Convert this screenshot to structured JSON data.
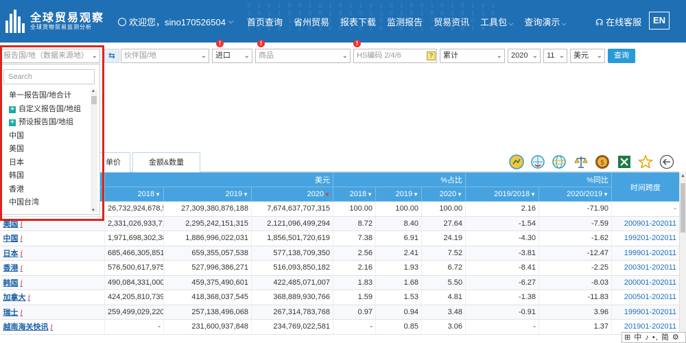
{
  "header": {
    "title": "全球贸易观察",
    "subtitle": "全球货物贸易监测分析",
    "user_text": "欢迎您，sino170526504",
    "nav": [
      {
        "label": "首页查询",
        "caret": false
      },
      {
        "label": "省州贸易",
        "caret": false
      },
      {
        "label": "报表下载",
        "caret": false
      },
      {
        "label": "监测报告",
        "caret": false
      },
      {
        "label": "贸易资讯",
        "caret": false
      },
      {
        "label": "工具包",
        "caret": true
      },
      {
        "label": "查询演示",
        "caret": true
      }
    ],
    "service": "在线客服",
    "lang": "EN"
  },
  "filters": {
    "reporter_placeholder": "报告国/地（数据来源地）",
    "partner_placeholder": "伙伴国/地",
    "flow": "进口",
    "commodity_placeholder": "商品",
    "hs_placeholder": "HS编码 2/4/6",
    "help": "?",
    "period_type": "累计",
    "year": "2020",
    "month": "11",
    "currency": "美元",
    "query_button": "查询",
    "warn": "!"
  },
  "dropdown": {
    "search_placeholder": "Search",
    "options": [
      {
        "label": "单一报告国/地合计",
        "plus": false
      },
      {
        "label": "自定义报告国/地组",
        "plus": true
      },
      {
        "label": "预设报告国/地组",
        "plus": true
      },
      {
        "label": "中国",
        "plus": false
      },
      {
        "label": "美国",
        "plus": false
      },
      {
        "label": "日本",
        "plus": false
      },
      {
        "label": "韩国",
        "plus": false
      },
      {
        "label": "香港",
        "plus": false
      },
      {
        "label": "中国台湾",
        "plus": false
      }
    ]
  },
  "tabs": [
    {
      "label": "单价"
    },
    {
      "label": "金额&数量"
    }
  ],
  "toolbar_icons": [
    "globe-chart-icon",
    "globe-refresh-icon",
    "globe-network-icon",
    "scale-icon",
    "coin-icon",
    "excel-icon",
    "star-icon",
    "back-arrow-icon"
  ],
  "table": {
    "group_headers": {
      "usd": "美元",
      "share": "%占比",
      "yoy": "%同比",
      "period": "时间跨度"
    },
    "columns": [
      "2018",
      "2019",
      "2020",
      "2018",
      "2019",
      "2020",
      "2019/2018",
      "2020/2019"
    ],
    "rows": [
      {
        "name": "",
        "marker": "",
        "v2018": "26,732,924,678,573",
        "v2019": "27,309,380,876,188",
        "v2020": "7,674,637,707,315",
        "s2018": "100.00",
        "s2019": "100.00",
        "s2020": "100.00",
        "y1": "2.16",
        "y2": "-71.90",
        "period": "-"
      },
      {
        "name": "美国",
        "marker": "i",
        "v2018": "2,331,026,933,719",
        "v2019": "2,295,242,151,315",
        "v2020": "2,121,096,499,294",
        "s2018": "8.72",
        "s2019": "8.40",
        "s2020": "27.64",
        "y1": "-1.54",
        "y2": "-7.59",
        "period": "200901-202011"
      },
      {
        "name": "中国",
        "marker": "i",
        "v2018": "1,971,698,302,386",
        "v2019": "1,886,996,022,031",
        "v2020": "1,856,501,720,619",
        "s2018": "7.38",
        "s2019": "6.91",
        "s2020": "24.19",
        "y1": "-4.30",
        "y2": "-1.62",
        "period": "199201-202011"
      },
      {
        "name": "日本",
        "marker": "i",
        "v2018": "685,466,305,851",
        "v2019": "659,355,057,538",
        "v2020": "577,138,709,350",
        "s2018": "2.56",
        "s2019": "2.41",
        "s2020": "7.52",
        "y1": "-3.81",
        "y2": "-12.47",
        "period": "199901-202011"
      },
      {
        "name": "香港",
        "marker": "i",
        "v2018": "576,500,617,975",
        "v2019": "527,996,386,271",
        "v2020": "516,093,850,182",
        "s2018": "2.16",
        "s2019": "1.93",
        "s2020": "6.72",
        "y1": "-8.41",
        "y2": "-2.25",
        "period": "200301-202011"
      },
      {
        "name": "韩国",
        "marker": "i",
        "v2018": "490,084,331,000",
        "v2019": "459,375,490,601",
        "v2020": "422,485,071,007",
        "s2018": "1.83",
        "s2019": "1.68",
        "s2020": "5.50",
        "y1": "-6.27",
        "y2": "-8.03",
        "period": "200001-202011"
      },
      {
        "name": "加拿大",
        "marker": "i",
        "v2018": "424,205,810,739",
        "v2019": "418,368,037,545",
        "v2020": "368,889,930,766",
        "s2018": "1.59",
        "s2019": "1.53",
        "s2020": "4.81",
        "y1": "-1.38",
        "y2": "-11.83",
        "period": "200501-202011"
      },
      {
        "name": "瑞士",
        "marker": "i",
        "v2018": "259,499,029,220",
        "v2019": "257,138,496,068",
        "v2020": "267,314,783,768",
        "s2018": "0.97",
        "s2019": "0.94",
        "s2020": "3.48",
        "y1": "-0.91",
        "y2": "3.96",
        "period": "199901-202011"
      },
      {
        "name": "越南海关快讯",
        "marker": "i",
        "v2018": "-",
        "v2019": "231,600,937,848",
        "v2020": "234,769,022,581",
        "s2018": "-",
        "s2019": "0.85",
        "s2020": "3.06",
        "y1": "-",
        "y2": "1.37",
        "period": "201901-202011"
      }
    ]
  },
  "ime": "中 ♪ •, 简 ⚙"
}
